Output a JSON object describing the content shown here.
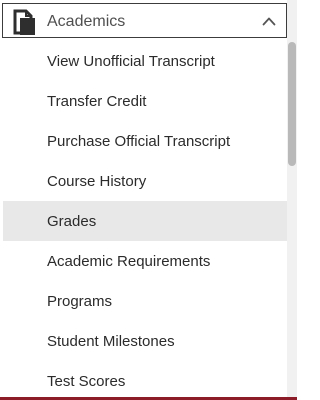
{
  "section": {
    "title": "Academics",
    "icon": "document-icon",
    "expanded": true
  },
  "menu": {
    "items": [
      {
        "label": "View Unofficial Transcript",
        "selected": false
      },
      {
        "label": "Transfer Credit",
        "selected": false
      },
      {
        "label": "Purchase Official Transcript",
        "selected": false
      },
      {
        "label": "Course History",
        "selected": false
      },
      {
        "label": "Grades",
        "selected": true
      },
      {
        "label": "Academic Requirements",
        "selected": false
      },
      {
        "label": "Programs",
        "selected": false
      },
      {
        "label": "Student Milestones",
        "selected": false
      },
      {
        "label": "Test Scores",
        "selected": false
      }
    ]
  },
  "colors": {
    "selected_bg": "#e8e8e8",
    "accent_bar": "#8c1d28",
    "text": "#2b2b2b"
  }
}
